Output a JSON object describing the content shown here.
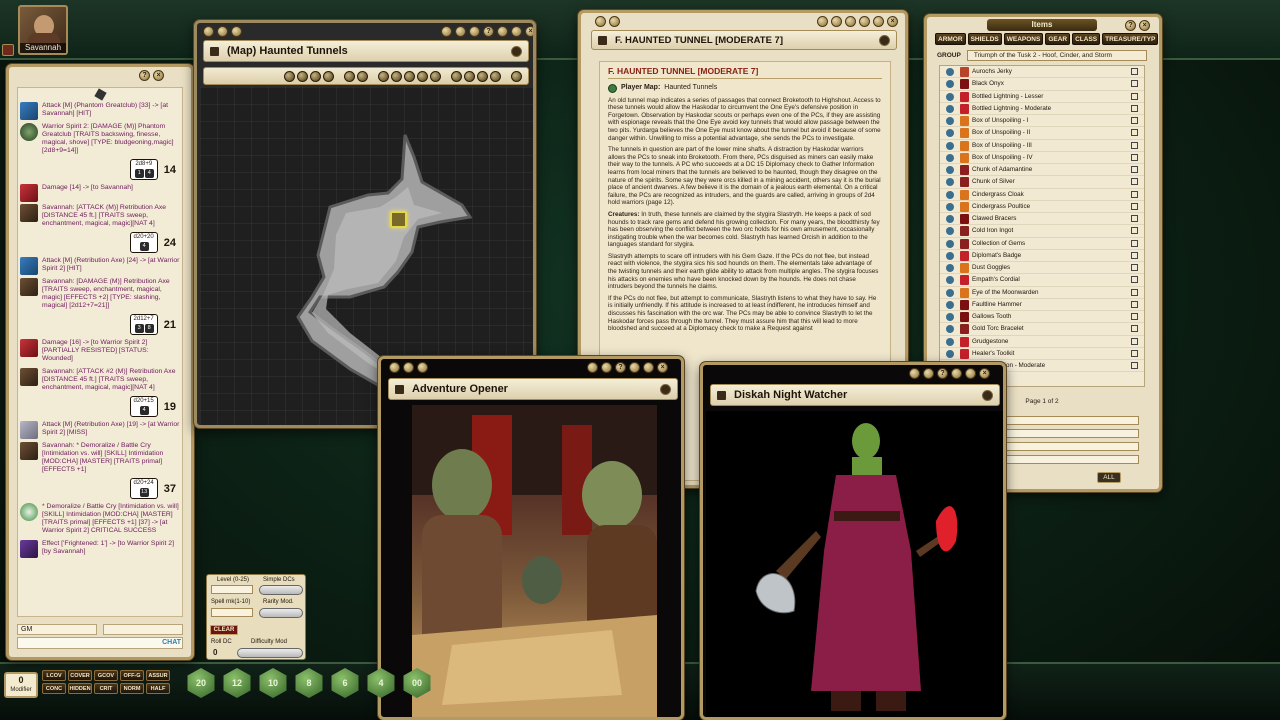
{
  "portrait": {
    "name": "Savannah"
  },
  "chat": {
    "entries": [
      {
        "icon": "attack",
        "text": "Attack [M] (Phantom Greatclub) [33] -> [at Savannah] [HIT]"
      },
      {
        "icon": "spirit",
        "text": "Warrior Spirit 2: [DAMAGE (M)] Phantom Greatclub [TRAITS backswing, finesse, magical, shove] [TYPE: bludgeoning,magic] [2d8+9=14]]"
      },
      {
        "icon": "damage",
        "text": "Damage [14] -> [to Savannah]"
      },
      {
        "icon": "char",
        "text": "Savannah: [ATTACK (M)] Retribution Axe [DISTANCE 45 ft.] [TRAITS sweep, enchantment, magical, magic][NAT 4]"
      },
      {
        "icon": "attack",
        "text": "Attack [M] (Retribution Axe) [24] -> [at Warrior Spirit 2] [HIT]"
      },
      {
        "icon": "char",
        "text": "Savannah: [DAMAGE (M)] Retribution Axe [TRAITS sweep, enchantment, magical, magic] [EFFECTS +2] [TYPE: slashing, magical] [2d12+7=21]]"
      },
      {
        "icon": "damage",
        "text": "Damage [16] -> [to Warrior Spirit 2] [PARTIALLY RESISTED] [STATUS: Wounded]"
      },
      {
        "icon": "char",
        "text": "Savannah: [ATTACK #2 (M)] Retribution Axe [DISTANCE 45 ft.] [TRAITS sweep, enchantment, magical, magic][NAT 4]"
      },
      {
        "icon": "skill",
        "text": "Attack [M] (Retribution Axe) [19] -> [at Warrior Spirit 2] [MISS]"
      },
      {
        "icon": "char",
        "text": "Savannah: * Demoralize / Battle Cry [Intimidation vs. will] [SKILL] Intimidation [MOD:CHA] [MASTER] [TRAITS primal] [EFFECTS +1]"
      },
      {
        "icon": "check",
        "text": "* Demoralize / Battle Cry [Intimidation vs. will] [SKILL] Intimidation [MOD:CHA] [MASTER] [TRAITS primal] [EFFECTS +1] [37] -> [at Warrior Spirit 2] CRITICAL SUCCESS"
      },
      {
        "icon": "effect",
        "text": "Effect ['Frightened: 1'] -> [to Warrior Spirit 2] [by Savannah]"
      }
    ],
    "rolls": [
      {
        "formula": "2d8+9",
        "dice": [
          "1",
          "4"
        ],
        "total": "14"
      },
      {
        "formula": "d20+20",
        "dice": [
          "4"
        ],
        "total": "24"
      },
      {
        "formula": "2d12+7",
        "dice": [
          "3",
          "8"
        ],
        "total": "21"
      },
      {
        "formula": "d20+15",
        "dice": [
          "4"
        ],
        "total": "19"
      },
      {
        "formula": "d20+24",
        "dice": [
          "13"
        ],
        "total": "37"
      }
    ],
    "mode_select": "GM",
    "label": "CHAT"
  },
  "map": {
    "title": "(Map) Haunted Tunnels"
  },
  "story": {
    "title": "F. HAUNTED TUNNEL [MODERATE 7]",
    "heading": "F. HAUNTED TUNNEL [MODERATE 7]",
    "player_map_label": "Player Map:",
    "player_map_link": "Haunted Tunnels",
    "p1": "An old tunnel map indicates a series of passages that connect Broketooth to Highshout. Access to these tunnels would allow the Haskodar to circumvent the One Eye's defensive position in Forgetown. Observation by Haskodar scouts or perhaps even one of the PCs, if they are assisting with espionage reveals that the One Eye avoid key tunnels that would allow passage between the two pits. Yurdarga believes the One Eye must know about the tunnel but avoid it because of some danger within. Unwilling to miss a potential advantage, she sends the PCs to investigate.",
    "p2": "The tunnels in question are part of the lower mine shafts. A distraction by Haskodar warriors allows the PCs to sneak into Broketooth. From there, PCs disguised as miners can easily make their way to the tunnels. A PC who succeeds at a DC 15 Diplomacy check to Gather Information learns from local miners that the tunnels are believed to be haunted, though they disagree on the nature of the spirits. Some say they were orcs killed in a mining accident, others say it is the burial place of ancient dwarves. A few believe it is the domain of a jealous earth elemental. On a critical failure, the PCs are recognized as intruders, and the guards are called, arriving in groups of 2d4 hold warriors (page 12).",
    "p3_label": "Creatures:",
    "p3": "In truth, these tunnels are claimed by the stygira Slastryth. He keeps a pack of sod hounds to track rare gems and defend his growing collection. For many years, the bloodthirsty fey has been observing the conflict between the two orc holds for his own amusement, occasionally instigating trouble when the war becomes cold. Slastryth has learned Orcish in addition to the languages standard for stygira.",
    "p4": "Slastryth attempts to scare off intruders with his Gem Gaze. If the PCs do not flee, but instead react with violence, the stygira sics his sod hounds on them. The elementals take advantage of the twisting tunnels and their earth glide ability to attack from multiple angles. The stygira focuses his attacks on enemies who have been knocked down by the hounds. He does not chase intruders beyond the tunnels he claims.",
    "p5": "If the PCs do not flee, but attempt to communicate, Slastryth listens to what they have to say. He is initially unfriendly. If his attitude is increased to at least indifferent, he introduces himself and discusses his fascination with the orc war. The PCs may be able to convince Slastryth to let the Haskodar forces pass through the tunnel. They must assure him that this will lead to more bloodshed and succeed at a Diplomacy check to make a Request against"
  },
  "items": {
    "title": "Items",
    "filters": [
      "ARMOR",
      "SHIELDS",
      "WEAPONS",
      "GEAR",
      "CLASS",
      "TREASURE/TYP",
      "TREASURE/LEVEL"
    ],
    "group_label": "GROUP",
    "group_value": "Triumph of the Tusk 2 - Hoof, Cinder, and Storm",
    "list": [
      {
        "name": "Aurochs Jerky",
        "color": "#b8442a"
      },
      {
        "name": "Black Onyx",
        "color": "#7a1010"
      },
      {
        "name": "Bottled Lightning - Lesser",
        "color": "#c4202a"
      },
      {
        "name": "Bottled Lightning - Moderate",
        "color": "#c4202a"
      },
      {
        "name": "Box of Unspoiling - I",
        "color": "#d9741c"
      },
      {
        "name": "Box of Unspoiling - II",
        "color": "#d9741c"
      },
      {
        "name": "Box of Unspoiling - III",
        "color": "#d9741c"
      },
      {
        "name": "Box of Unspoiling - IV",
        "color": "#d9741c"
      },
      {
        "name": "Chunk of Adamantine",
        "color": "#8a1f1f"
      },
      {
        "name": "Chunk of Silver",
        "color": "#8a1f1f"
      },
      {
        "name": "Cindergrass Cloak",
        "color": "#d9741c"
      },
      {
        "name": "Cindergrass Poultice",
        "color": "#d9741c"
      },
      {
        "name": "Clawed Bracers",
        "color": "#7a1010"
      },
      {
        "name": "Cold Iron Ingot",
        "color": "#8a1f1f"
      },
      {
        "name": "Collection of Gems",
        "color": "#8a1f1f"
      },
      {
        "name": "Diplomat's Badge",
        "color": "#c4202a"
      },
      {
        "name": "Dust Goggles",
        "color": "#d9741c"
      },
      {
        "name": "Empath's Cordial",
        "color": "#c4202a"
      },
      {
        "name": "Eye of the Moonwarden",
        "color": "#d9741c"
      },
      {
        "name": "Faultline Hammer",
        "color": "#7a1010"
      },
      {
        "name": "Gallows Tooth",
        "color": "#7a1010"
      },
      {
        "name": "Gold Torc Bracelet",
        "color": "#8a1f1f"
      },
      {
        "name": "Grudgestone",
        "color": "#c4202a"
      },
      {
        "name": "Healer's Toolkit",
        "color": "#c4202a"
      },
      {
        "name": "Healing Potion - Moderate",
        "color": "#c4202a"
      }
    ],
    "pager": "Page 1 of 2",
    "search_labels": [
      "Category",
      "Item Type",
      "Level",
      "Cost"
    ],
    "all_label": "ALL"
  },
  "opener": {
    "title": "Adventure Opener"
  },
  "watcher": {
    "title": "Diskah Night Watcher"
  },
  "calc": {
    "level_label": "Level (0-25)",
    "simple_label": "Simple DCs",
    "spell_label": "Spell rnk(1-10)",
    "rarity_label": "Rarity Mod.",
    "clear_label": "CLEAR",
    "rolldc_label": "Roll DC",
    "rolldc_value": "0",
    "difficulty_label": "Difficulty Mod"
  },
  "hotbar": {
    "modifier_value": "0",
    "modifier_label": "Modifier",
    "buttons": [
      "LCOV",
      "COVER",
      "GCOV",
      "OFF-G",
      "ASSUR",
      "CONC",
      "HIDDEN",
      "CRIT",
      "NORM",
      "HALF"
    ],
    "dice": [
      "20",
      "12",
      "10",
      "8",
      "6",
      "4",
      "00"
    ]
  }
}
